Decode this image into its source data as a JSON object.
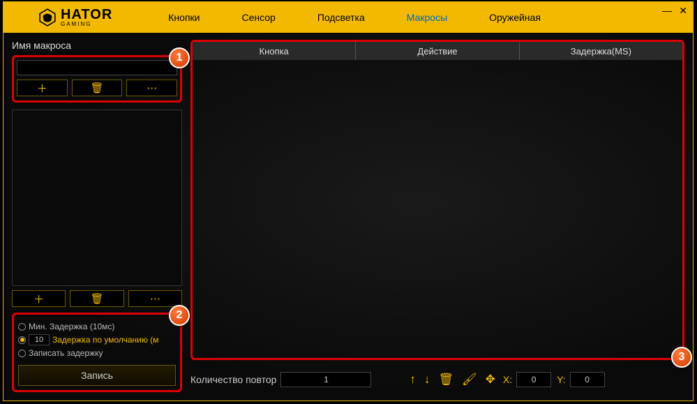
{
  "brand": {
    "name": "HATOR",
    "sub": "GAMING"
  },
  "tabs": [
    "Кнопки",
    "Сенсор",
    "Подсветка",
    "Макросы",
    "Оружейная"
  ],
  "activeTabIndex": 3,
  "left": {
    "label": "Имя макроса",
    "nameValue": "",
    "defaultDelay": "10",
    "opt1": "Мин. Задержка (10мс)",
    "opt2": "Задержка по умолчанию (м",
    "opt3": "Записать задержку",
    "recordBtn": "Запись"
  },
  "table": {
    "cols": [
      "Кнопка",
      "Действие",
      "Задержка(MS)"
    ]
  },
  "bottom": {
    "countLabel": "Количество повтор",
    "countValue": "1",
    "xLabel": "X:",
    "yLabel": "Y:",
    "xValue": "0",
    "yValue": "0"
  },
  "callouts": {
    "a": "1",
    "b": "2",
    "c": "3"
  }
}
